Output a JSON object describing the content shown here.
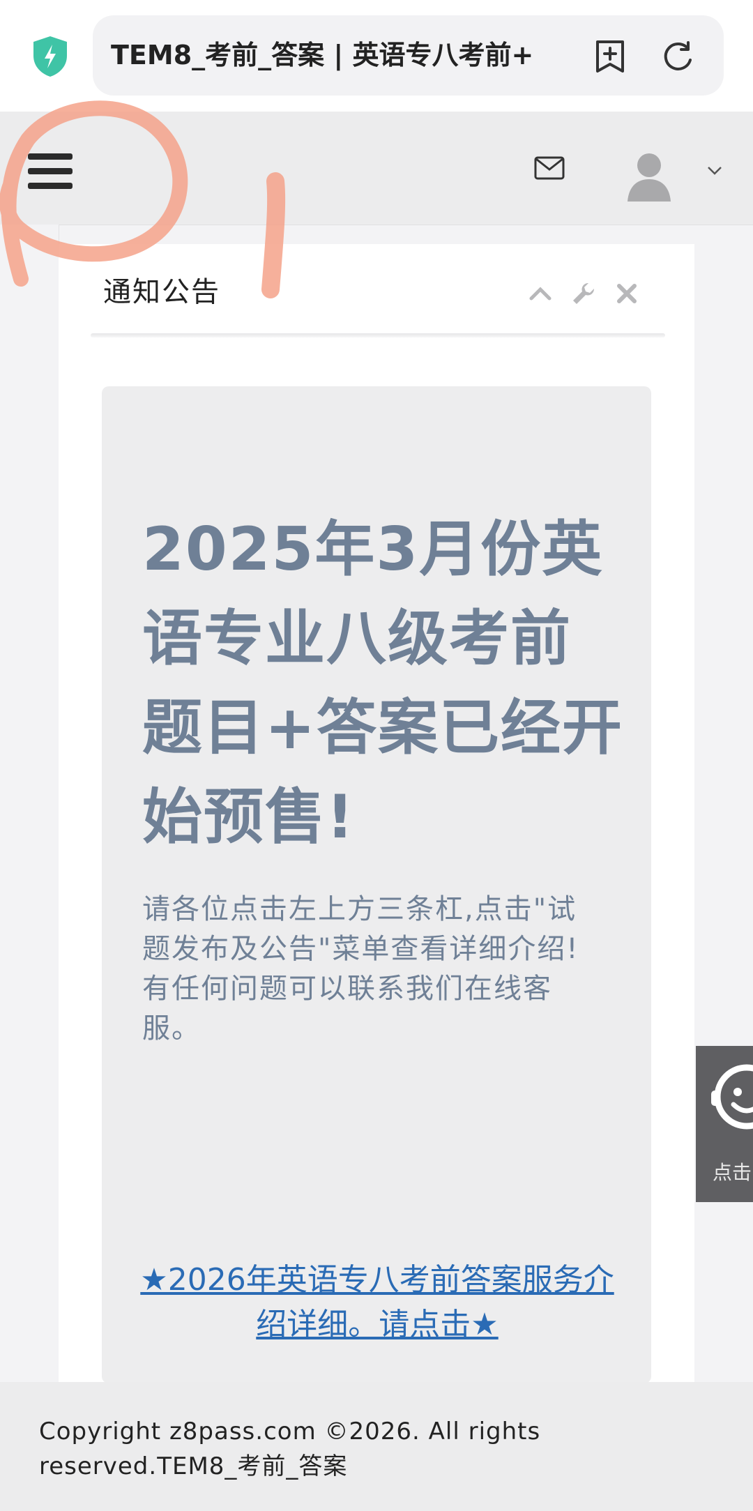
{
  "browser": {
    "url_title": "TEM8_考前_答案 | 英语专八考前+"
  },
  "panel": {
    "title": "通知公告"
  },
  "notice": {
    "headline": "2025年3月份英语专业八级考前题目+答案已经开始预售!",
    "body": "请各位点击左上方三条杠,点击\"试题发布及公告\"菜单查看详细介绍!有任何问题可以联系我们在线客服。",
    "link": "★2026年英语专八考前答案服务介绍详细。请点击★"
  },
  "chat_widget": {
    "label": "点击"
  },
  "footer": {
    "copyright": "Copyright z8pass.com ©2026. All rights reserved.TEM8_考前_答案"
  },
  "colors": {
    "headline": "#6f8096",
    "link": "#2a6bb5",
    "shield": "#3fc4a6",
    "scribble": "#f4a28a"
  },
  "icons": [
    "shield-icon",
    "bookmark-add-icon",
    "refresh-icon",
    "hamburger-menu-icon",
    "mail-icon",
    "avatar-icon",
    "chevron-down-icon",
    "chevron-up-icon",
    "wrench-icon",
    "close-icon",
    "chat-face-icon"
  ]
}
